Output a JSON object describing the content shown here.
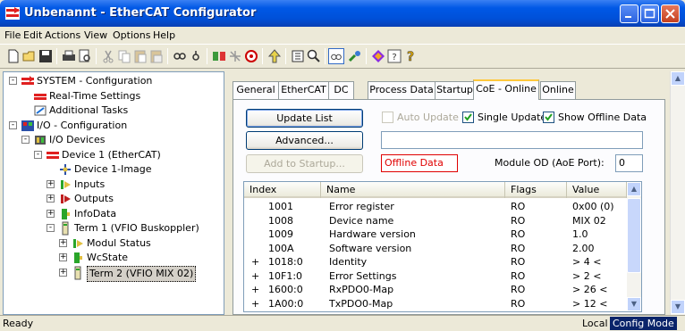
{
  "window": {
    "title": "Unbenannt - EtherCAT Configurator"
  },
  "menu": [
    "File",
    "Edit",
    "Actions",
    "View",
    "Options",
    "Help"
  ],
  "toolbar": {
    "icons": [
      "new-icon",
      "open-icon",
      "save-icon",
      "print-icon",
      "print-preview-icon",
      "cut-icon",
      "copy-icon",
      "paste-icon",
      "paste-special-icon",
      "find-icon",
      "find-next-icon",
      "scan-devices-icon",
      "reload-icon",
      "toggle-free-run-icon",
      "sort-icon",
      "insert-icon",
      "zoom-icon",
      "online-watch-icon",
      "config-mode-icon",
      "diagnose-icon",
      "help-icon",
      "context-help-icon"
    ]
  },
  "tree": [
    {
      "label": "SYSTEM - Configuration",
      "icon": "system-config-icon",
      "level": 0,
      "expander": "-"
    },
    {
      "label": "Real-Time Settings",
      "icon": "realtime-icon",
      "level": 1,
      "expander": ""
    },
    {
      "label": "Additional Tasks",
      "icon": "tasks-icon",
      "level": 1,
      "expander": ""
    },
    {
      "label": "I/O - Configuration",
      "icon": "io-config-icon",
      "level": 0,
      "expander": "-"
    },
    {
      "label": "I/O Devices",
      "icon": "io-devices-icon",
      "level": 1,
      "expander": "-"
    },
    {
      "label": "Device 1 (EtherCAT)",
      "icon": "ethercat-device-icon",
      "level": 2,
      "expander": "-"
    },
    {
      "label": "Device 1-Image",
      "icon": "image-icon",
      "level": 3,
      "expander": ""
    },
    {
      "label": "Inputs",
      "icon": "inputs-icon",
      "level": 3,
      "expander": "+"
    },
    {
      "label": "Outputs",
      "icon": "outputs-icon",
      "level": 3,
      "expander": "+"
    },
    {
      "label": "InfoData",
      "icon": "infodata-icon",
      "level": 3,
      "expander": "+"
    },
    {
      "label": "Term 1 (VFIO Buskoppler)",
      "icon": "terminal-icon",
      "level": 3,
      "expander": "-"
    },
    {
      "label": "Modul Status",
      "icon": "inputs-icon",
      "level": 4,
      "expander": "+"
    },
    {
      "label": "WcState",
      "icon": "infodata-icon",
      "level": 4,
      "expander": "+"
    },
    {
      "label": "Term 2 (VFIO MIX 02)",
      "icon": "terminal-icon",
      "level": 4,
      "expander": "+",
      "selected": true
    }
  ],
  "tabs": [
    "General",
    "EtherCAT",
    "DC",
    "Process Data",
    "Startup",
    "CoE - Online",
    "Online"
  ],
  "active_tab": "CoE - Online",
  "coe": {
    "update_list": "Update List",
    "advanced": "Advanced...",
    "add_to_startup": "Add to Startup...",
    "auto_update": "Auto Update",
    "single_update": "Single Update",
    "show_offline": "Show Offline Data",
    "offline_data": "Offline Data",
    "module_od_label": "Module OD (AoE Port):",
    "module_od_value": "0",
    "columns": [
      "Index",
      "Name",
      "Flags",
      "Value"
    ],
    "rows": [
      {
        "exp": "",
        "index": "1001",
        "name": "Error register",
        "flags": "RO",
        "value": "0x00 (0)"
      },
      {
        "exp": "",
        "index": "1008",
        "name": "Device name",
        "flags": "RO",
        "value": "MIX 02"
      },
      {
        "exp": "",
        "index": "1009",
        "name": "Hardware version",
        "flags": "RO",
        "value": "1.0"
      },
      {
        "exp": "",
        "index": "100A",
        "name": "Software version",
        "flags": "RO",
        "value": "2.00"
      },
      {
        "exp": "+",
        "index": "1018:0",
        "name": "Identity",
        "flags": "RO",
        "value": "> 4 <"
      },
      {
        "exp": "+",
        "index": "10F1:0",
        "name": "Error Settings",
        "flags": "RO",
        "value": "> 2 <"
      },
      {
        "exp": "+",
        "index": "1600:0",
        "name": "RxPDO0-Map",
        "flags": "RO",
        "value": "> 26 <"
      },
      {
        "exp": "+",
        "index": "1A00:0",
        "name": "TxPDO0-Map",
        "flags": "RO",
        "value": "> 12 <"
      }
    ]
  },
  "status": {
    "left": "Ready",
    "local": "Local",
    "mode": "Config Mode"
  }
}
